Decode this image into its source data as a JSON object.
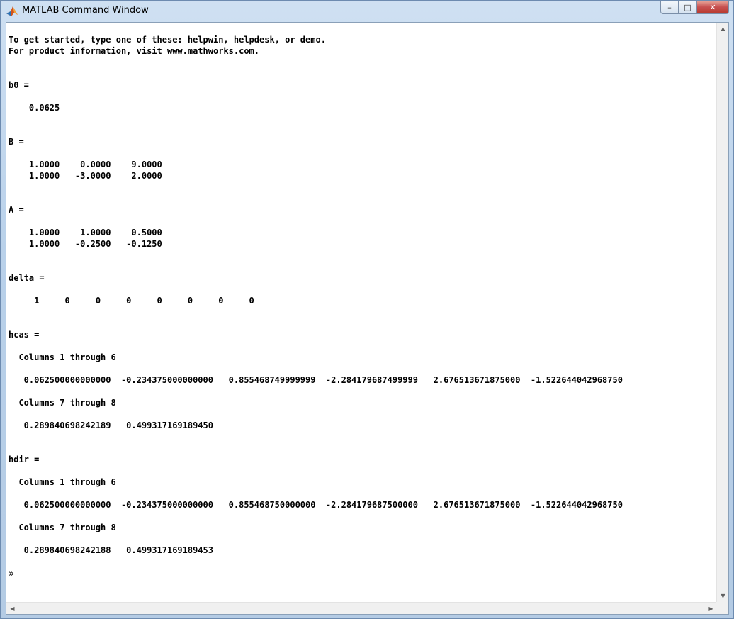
{
  "window": {
    "title": "MATLAB Command Window",
    "buttons": {
      "minimize": "–",
      "maximize": "□",
      "close": "✕"
    }
  },
  "console": {
    "text": "To get started, type one of these: helpwin, helpdesk, or demo.\nFor product information, visit www.mathworks.com.\n\n\nb0 =\n\n    0.0625\n\n\nB =\n\n    1.0000    0.0000    9.0000\n    1.0000   -3.0000    2.0000\n\n\nA =\n\n    1.0000    1.0000    0.5000\n    1.0000   -0.2500   -0.1250\n\n\ndelta =\n\n     1     0     0     0     0     0     0     0\n\n\nhcas =\n\n  Columns 1 through 6\n\n   0.062500000000000  -0.234375000000000   0.855468749999999  -2.284179687499999   2.676513671875000  -1.522644042968750\n\n  Columns 7 through 8\n\n   0.289840698242189   0.499317169189450\n\n\nhdir =\n\n  Columns 1 through 6\n\n   0.062500000000000  -0.234375000000000   0.855468750000000  -2.284179687500000   2.676513671875000  -1.522644042968750\n\n  Columns 7 through 8\n\n   0.289840698242188   0.499317169189453",
    "prompt": "»"
  },
  "icons": {
    "app": "matlab-icon",
    "scroll_up": "▲",
    "scroll_down": "▼",
    "scroll_left": "◀",
    "scroll_right": "▶"
  }
}
